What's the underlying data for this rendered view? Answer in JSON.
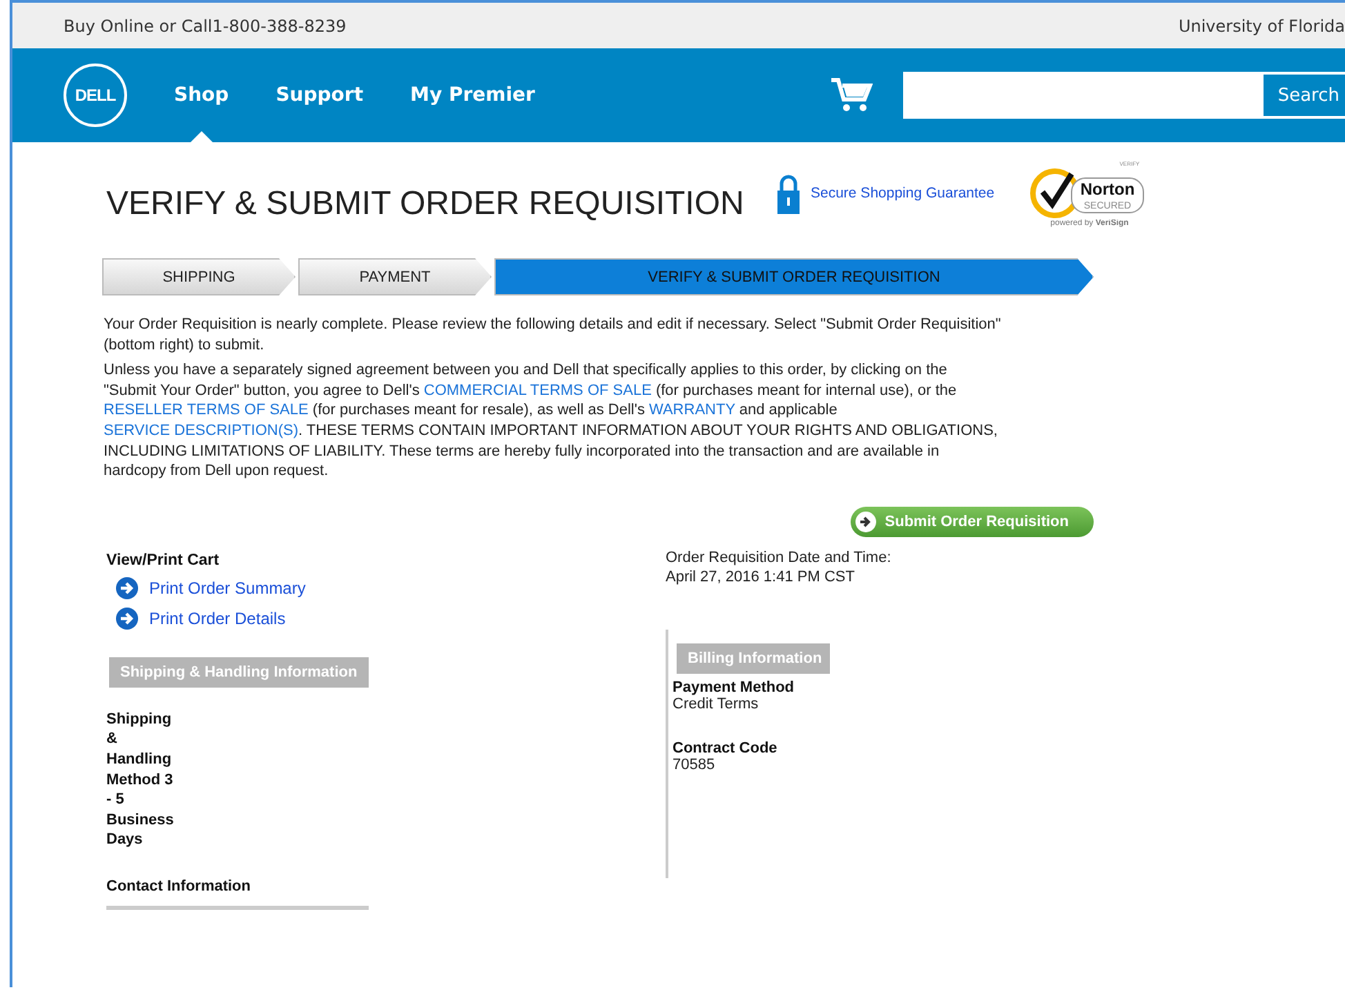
{
  "top_bar": {
    "contact": "Buy Online or Call1-800-388-8239",
    "account": "University of Florida"
  },
  "nav": {
    "logo": "DELL",
    "items": [
      {
        "label": "Shop",
        "selected": true
      },
      {
        "label": "Support",
        "selected": false
      },
      {
        "label": "My Premier",
        "selected": false
      }
    ],
    "search_button": "Search"
  },
  "title": "VERIFY & SUBMIT ORDER REQUISITION",
  "secure_link": "Secure Shopping Guarantee",
  "norton": {
    "verify": "VERIFY",
    "name": "Norton",
    "label": "SECURED",
    "tagline": "powered by **VeriSign**"
  },
  "steps": [
    {
      "label": "SHIPPING",
      "selected": false
    },
    {
      "label": "PAYMENT",
      "selected": false
    },
    {
      "label": "VERIFY & SUBMIT ORDER REQUISITION",
      "selected": true
    }
  ],
  "intro": "Your Order Requisition is nearly complete. Please review the following details and edit if necessary. Select \"Submit Order Requisition\" (bottom right) to submit.",
  "terms": [
    {
      "kind": "text",
      "text": "Unless you have a separately signed agreement between you and Dell that specifically applies to this order, by clicking on the \"Submit Your Order\" button, you agree to Dell's "
    },
    {
      "kind": "link",
      "text": "COMMERCIAL TERMS OF SALE"
    },
    {
      "kind": "text",
      "text": " (for purchases meant for internal use), or the "
    },
    {
      "kind": "link",
      "text": "RESELLER TERMS OF SALE"
    },
    {
      "kind": "text",
      "text": " (for purchases meant for resale), as well as Dell's "
    },
    {
      "kind": "link",
      "text": "WARRANTY"
    },
    {
      "kind": "text",
      "text": " and applicable "
    },
    {
      "kind": "link",
      "text": "SERVICE DESCRIPTION(S)"
    },
    {
      "kind": "text",
      "text": ". THESE TERMS CONTAIN IMPORTANT INFORMATION ABOUT YOUR RIGHTS AND OBLIGATIONS, INCLUDING LIMITATIONS OF LIABILITY. These terms are hereby fully incorporated into the transaction and are available in hardcopy from Dell upon request."
    }
  ],
  "submit_button": "Submit Order Requisition",
  "cart": {
    "heading": "View/Print Cart",
    "links": [
      "Print Order Summary",
      "Print Order Details"
    ]
  },
  "order_date": {
    "label": "Order Requisition Date and Time:",
    "value": "April 27, 2016 1:41 PM CST"
  },
  "shipping": {
    "heading": "Shipping & Handling Information",
    "method": "Shipping & Handling Method 3 - 5 Business Days",
    "contact_heading": "Contact Information"
  },
  "billing": {
    "heading": "Billing Information",
    "fields": [
      {
        "label": "Payment Method",
        "value": "Credit Terms"
      },
      {
        "label": "Contract Code",
        "value": "70585"
      }
    ]
  }
}
